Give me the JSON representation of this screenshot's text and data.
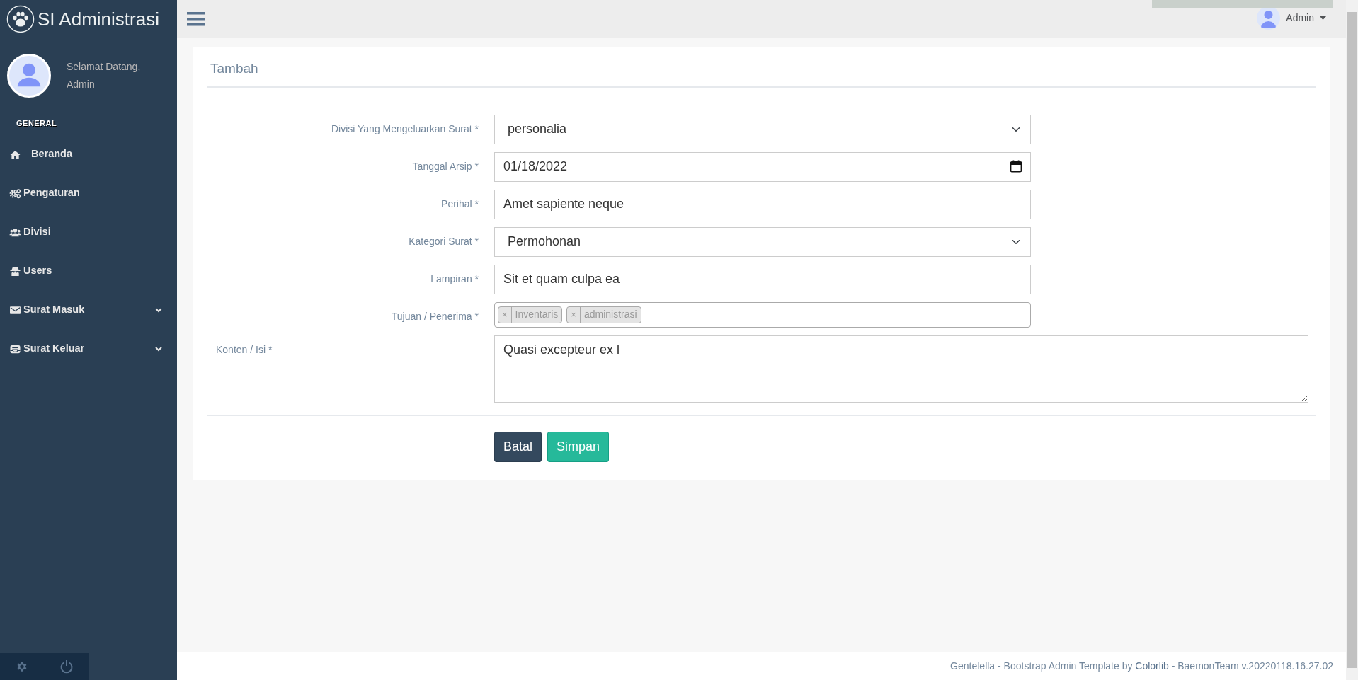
{
  "sidebar": {
    "brand": "SI Administrasi",
    "welcome": "Selamat Datang,",
    "user": "Admin",
    "section": "GENERAL",
    "items": [
      {
        "label": "Beranda",
        "expandable": false
      },
      {
        "label": "Pengaturan",
        "expandable": false
      },
      {
        "label": "Divisi",
        "expandable": false
      },
      {
        "label": "Users",
        "expandable": false
      },
      {
        "label": "Surat Masuk",
        "expandable": true
      },
      {
        "label": "Surat Keluar",
        "expandable": true
      }
    ]
  },
  "topbar": {
    "user": "Admin"
  },
  "panel": {
    "title": "Tambah",
    "fields": [
      {
        "kind": "select",
        "label": "Divisi Yang Mengeluarkan Surat *",
        "value": "personalia"
      },
      {
        "kind": "date",
        "label": "Tanggal Arsip *",
        "value": "01/18/2022"
      },
      {
        "kind": "text",
        "label": "Perihal *",
        "value": "Amet sapiente neque"
      },
      {
        "kind": "select",
        "label": "Kategori Surat *",
        "value": "Permohonan"
      },
      {
        "kind": "text",
        "label": "Lampiran *",
        "value": "Sit et quam culpa ea"
      },
      {
        "kind": "tags",
        "label": "Tujuan / Penerima *",
        "tags": [
          {
            "remove": "×",
            "label": "Inventaris"
          },
          {
            "remove": "×",
            "label": "administrasi"
          }
        ]
      },
      {
        "kind": "textarea",
        "label": "Konten / Isi *",
        "value": "Quasi excepteur ex l"
      }
    ],
    "buttons": [
      {
        "label": "Batal",
        "kind": "secondary"
      },
      {
        "label": "Simpan",
        "kind": "primary"
      }
    ]
  },
  "footer": {
    "before": "Gentelella - Bootstrap Admin Template by ",
    "link": "Colorlib",
    "after": " - BaemonTeam v.20220118.16.27.02"
  }
}
